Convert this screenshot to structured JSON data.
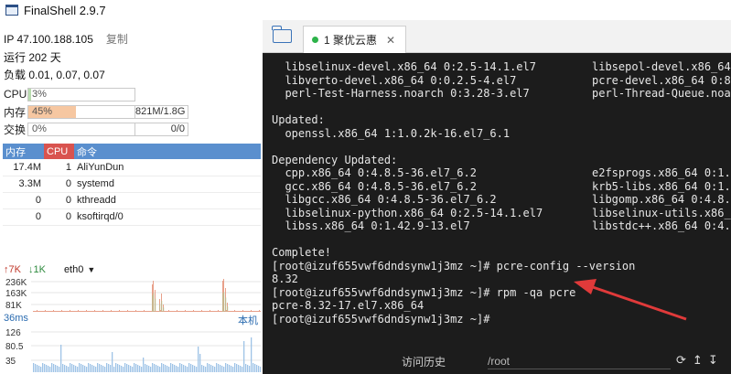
{
  "app": {
    "title": "FinalShell 2.9.7"
  },
  "server": {
    "ip_line": "IP 47.100.188.105",
    "copy_label": "复制",
    "uptime": "运行 202 天",
    "load": "负载 0.01, 0.07, 0.07"
  },
  "meters": {
    "cpu": {
      "label": "CPU",
      "value_text": "3%",
      "fraction": 0.03,
      "color": "#b9dcb0"
    },
    "mem": {
      "label": "内存",
      "value_text": "45%",
      "fraction": 0.45,
      "extra": "821M/1.8G",
      "color": "#f6c7a1"
    },
    "swap": {
      "label": "交换",
      "value_text": "0%",
      "fraction": 0.0,
      "extra": "0/0",
      "color": "#b9dcb0"
    }
  },
  "proc_table": {
    "headers": {
      "mem": "内存",
      "cpu": "CPU",
      "cmd": "命令"
    },
    "rows": [
      {
        "mem": "17.4M",
        "cpu": "1",
        "cmd": "AliYunDun"
      },
      {
        "mem": "3.3M",
        "cpu": "0",
        "cmd": "systemd"
      },
      {
        "mem": "0",
        "cpu": "0",
        "cmd": "kthreadd"
      },
      {
        "mem": "0",
        "cpu": "0",
        "cmd": "ksoftirqd/0"
      }
    ]
  },
  "network": {
    "up": "↑7K",
    "down": "↓1K",
    "interface": "eth0",
    "y_ticks": [
      "236K",
      "163K",
      "81K"
    ]
  },
  "latency": {
    "label": "36ms",
    "host_label": "本机",
    "y_ticks": [
      "126",
      "80.5",
      "35"
    ]
  },
  "tab": {
    "label": "1 聚优云惠"
  },
  "terminal": {
    "lines": [
      [
        "  libselinux-devel.x86_64 0:2.5-14.1.el7",
        "libsepol-devel.x86_64"
      ],
      [
        "  libverto-devel.x86_64 0:0.2.5-4.el7",
        "pcre-devel.x86_64 0:8."
      ],
      [
        "  perl-Test-Harness.noarch 0:3.28-3.el7",
        "perl-Thread-Queue.noar"
      ],
      [
        "",
        ""
      ],
      [
        "Updated:",
        ""
      ],
      [
        "  openssl.x86_64 1:1.0.2k-16.el7_6.1",
        ""
      ],
      [
        "",
        ""
      ],
      [
        "Dependency Updated:",
        ""
      ],
      [
        "  cpp.x86_64 0:4.8.5-36.el7_6.2",
        "e2fsprogs.x86_64 0:1."
      ],
      [
        "  gcc.x86_64 0:4.8.5-36.el7_6.2",
        "krb5-libs.x86_64 0:1."
      ],
      [
        "  libgcc.x86_64 0:4.8.5-36.el7_6.2",
        "libgomp.x86_64 0:4.8."
      ],
      [
        "  libselinux-python.x86_64 0:2.5-14.1.el7",
        "libselinux-utils.x86_"
      ],
      [
        "  libss.x86_64 0:1.42.9-13.el7",
        "libstdc++.x86_64 0:4."
      ],
      [
        "",
        ""
      ],
      [
        "Complete!",
        ""
      ],
      [
        "[root@izuf655vwf6dndsynw1j3mz ~]# pcre-config --version",
        ""
      ],
      [
        "8.32",
        ""
      ],
      [
        "[root@izuf655vwf6dndsynw1j3mz ~]# rpm -qa pcre",
        ""
      ],
      [
        "pcre-8.32-17.el7.x86_64",
        ""
      ],
      [
        "[root@izuf655vwf6dndsynw1j3mz ~]# ",
        ""
      ]
    ]
  },
  "bottom_bar": {
    "history_label": "访问历史",
    "path_value": "/root",
    "icons": [
      "refresh-icon",
      "upload-icon",
      "download-icon"
    ]
  },
  "colors": {
    "net_up": "#e8a08a",
    "net_down": "#a9c98f",
    "latency_bar": "#9ec3e6",
    "annotation_arrow": "#e03a3a"
  }
}
